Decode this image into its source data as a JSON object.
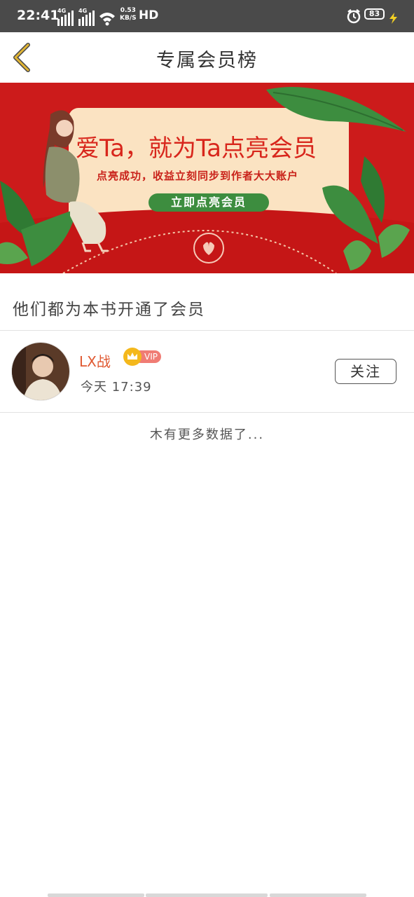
{
  "status_bar": {
    "time": "22:41",
    "network_speed_value": "0.53",
    "network_speed_unit": "KB/S",
    "hd_label": "HD",
    "battery_level": "83"
  },
  "header": {
    "title": "专属会员榜"
  },
  "banner": {
    "title": "爱Ta，就为Ta点亮会员",
    "subtitle": "点亮成功，收益立刻同步到作者大大账户",
    "cta_label": "立即点亮会员",
    "colors": {
      "background": "#cc1b1b",
      "letter": "#fbe3c2",
      "leaf": "#3d8d3f"
    }
  },
  "section": {
    "title": "他们都为本书开通了会员"
  },
  "members": [
    {
      "name": "LX战",
      "badge": "VIP",
      "time": "今天 17:39",
      "follow_label": "关注"
    }
  ],
  "footer": {
    "no_more_text": "木有更多数据了..."
  },
  "colors": {
    "accent_name": "#e05a33",
    "vip_pill": "#f07c74",
    "vip_crown": "#f4b81c",
    "status_bar": "#4a4a4a",
    "back_arrow": "#e3b634"
  }
}
